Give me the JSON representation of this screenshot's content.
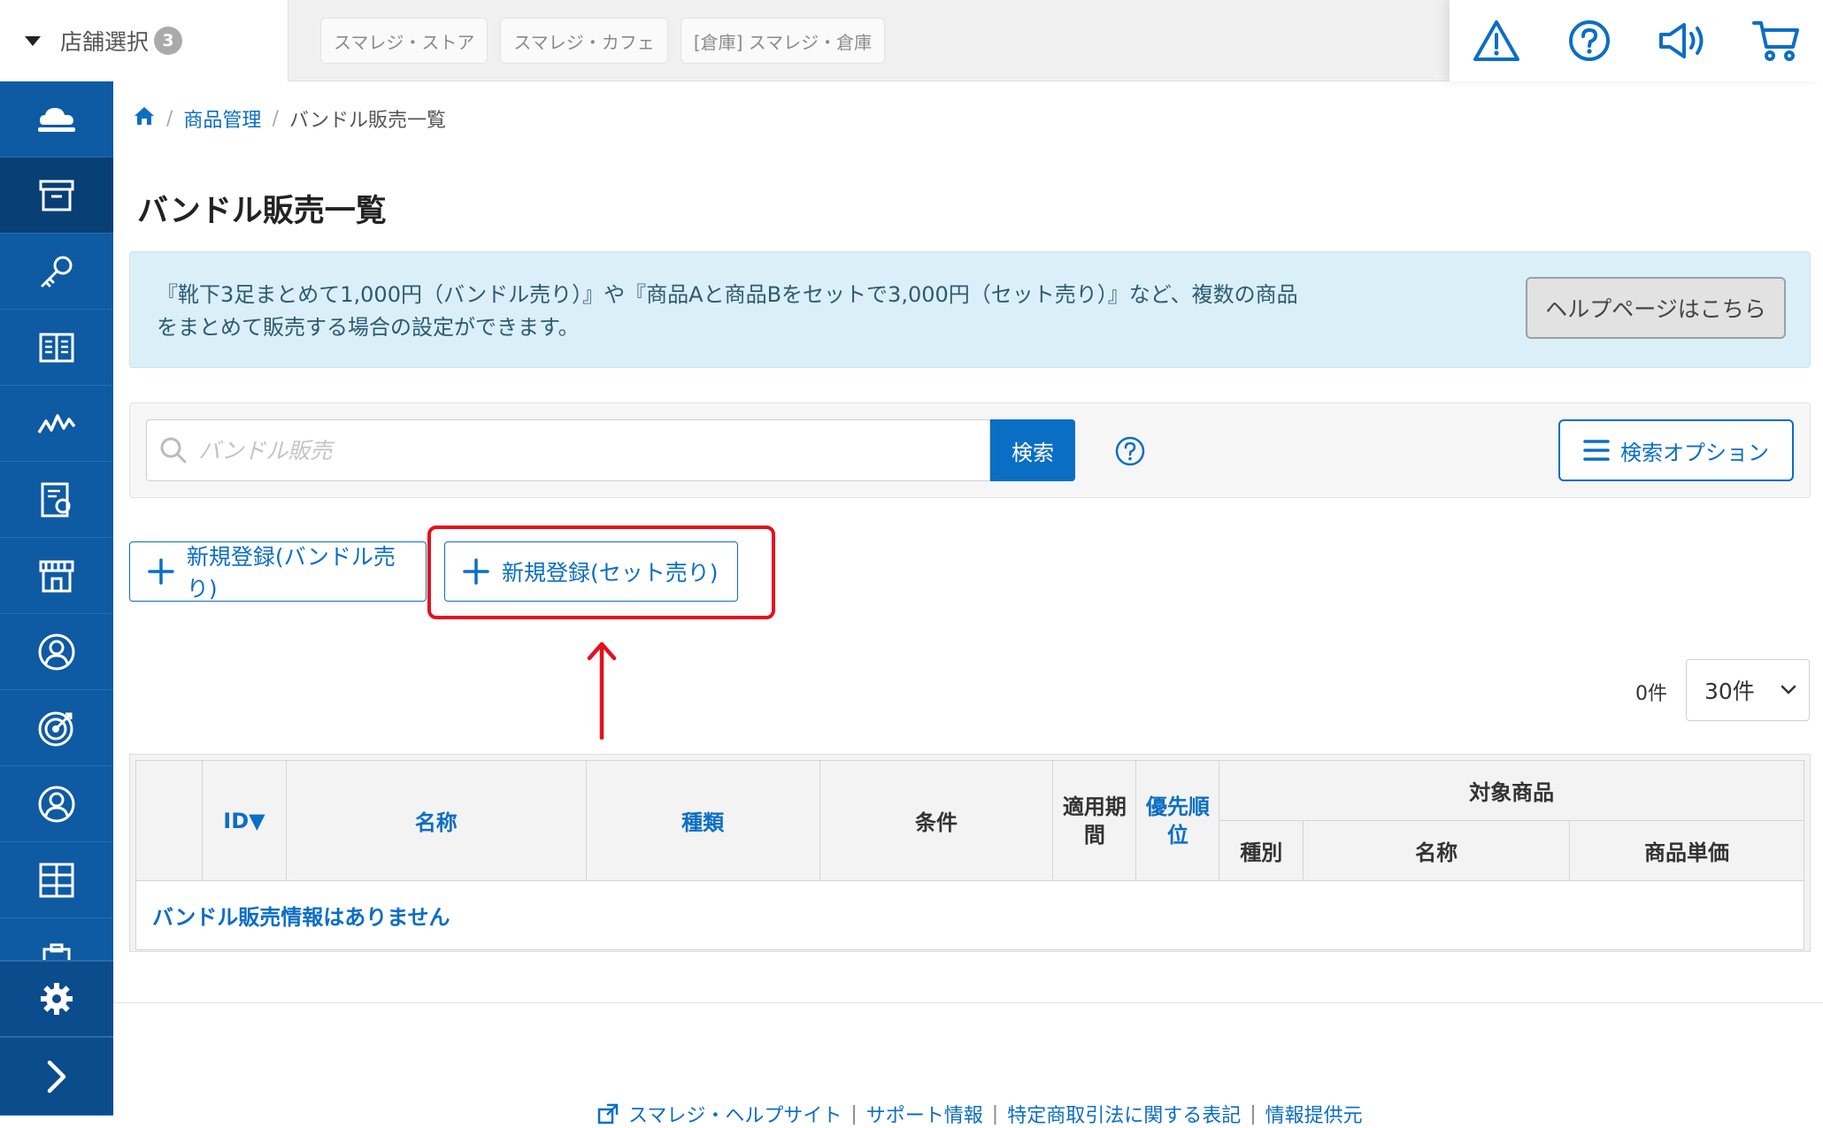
{
  "topbar": {
    "store_select_label": "店舗選択",
    "store_count": "3",
    "stores": [
      "スマレジ・ストア",
      "スマレジ・カフェ",
      "[倉庫] スマレジ・倉庫"
    ],
    "icons": [
      "warning-icon",
      "help-circle-icon",
      "megaphone-icon",
      "cart-icon"
    ]
  },
  "sidebar": {
    "items": [
      "cloud-icon",
      "product-box-icon",
      "key-icon",
      "book-icon",
      "chart-icon",
      "report-icon",
      "store-icon",
      "customer-icon",
      "target-icon",
      "user-icon",
      "grid-icon",
      "clipboard-icon"
    ],
    "settings_icon": "gear-icon",
    "expand_icon": "chevron-right-icon"
  },
  "breadcrumb": {
    "home_icon": "home-icon",
    "items": [
      "商品管理",
      "バンドル販売一覧"
    ]
  },
  "page": {
    "title": "バンドル販売一覧"
  },
  "info": {
    "line1": "『靴下3足まとめて1,000円（バンドル売り）』や『商品Aと商品Bをセットで3,000円（セット売り）』など、複数の商品",
    "line2": "をまとめて販売する場合の設定ができます。",
    "help_button": "ヘルプページはこちら"
  },
  "search": {
    "placeholder": "バンドル販売",
    "button": "検索",
    "options_button": "検索オプション"
  },
  "actions": {
    "new_bundle": "新規登録(バンドル売り)",
    "new_set": "新規登録(セット売り)"
  },
  "list": {
    "count": "0件",
    "per_page": "30件"
  },
  "table": {
    "headers": {
      "id": "ID▼",
      "name": "名称",
      "type": "種類",
      "condition": "条件",
      "period": "適用期間",
      "priority": "優先順位",
      "target": "対象商品",
      "target_kind": "種別",
      "target_name": "名称",
      "target_price": "商品単価"
    },
    "empty_message": "バンドル販売情報はありません"
  },
  "footer": {
    "links": [
      "スマレジ・ヘルプサイト",
      "サポート情報",
      "特定商取引法に関する表記",
      "情報提供元"
    ]
  },
  "colors": {
    "sidebar": "#0e5aa3",
    "sidebar_active": "#083f74",
    "accent": "#0b6ec5",
    "highlight": "#e4101e"
  }
}
